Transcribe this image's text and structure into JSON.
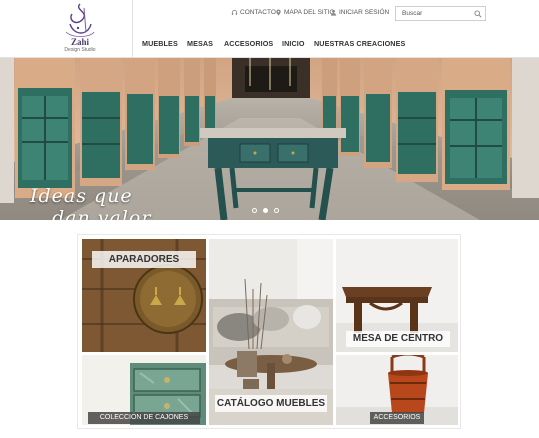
{
  "brand": {
    "name": "Zahi",
    "subtitle": "Design Studio"
  },
  "toplinks": [
    {
      "icon": "headset-icon",
      "label": "CONTACTO"
    },
    {
      "icon": "map-pin-icon",
      "label": "MAPA DEL SITIO"
    },
    {
      "icon": "user-icon",
      "label": "INICIAR SESIÓN"
    }
  ],
  "search": {
    "placeholder": "Buscar"
  },
  "nav": [
    "MUEBLES",
    "MESAS",
    "ACCESORIOS",
    "INICIO",
    "NUESTRAS CREACIONES"
  ],
  "hero": {
    "tagline_line1": "Ideas que",
    "tagline_line2": "dan valor..",
    "slides": 3,
    "active_slide": 1
  },
  "tiles": {
    "aparadores": "APARADORES",
    "catalogo": "CATÁLOGO MUEBLES",
    "mesa_centro": "MESA DE CENTRO",
    "cajones": "COLECCIÓN DE CAJONES",
    "accesorios": "ACCESORIOS"
  },
  "colors": {
    "text": "#333333",
    "tile_green": "#2f6f62",
    "wood_orange": "#b8481c"
  }
}
